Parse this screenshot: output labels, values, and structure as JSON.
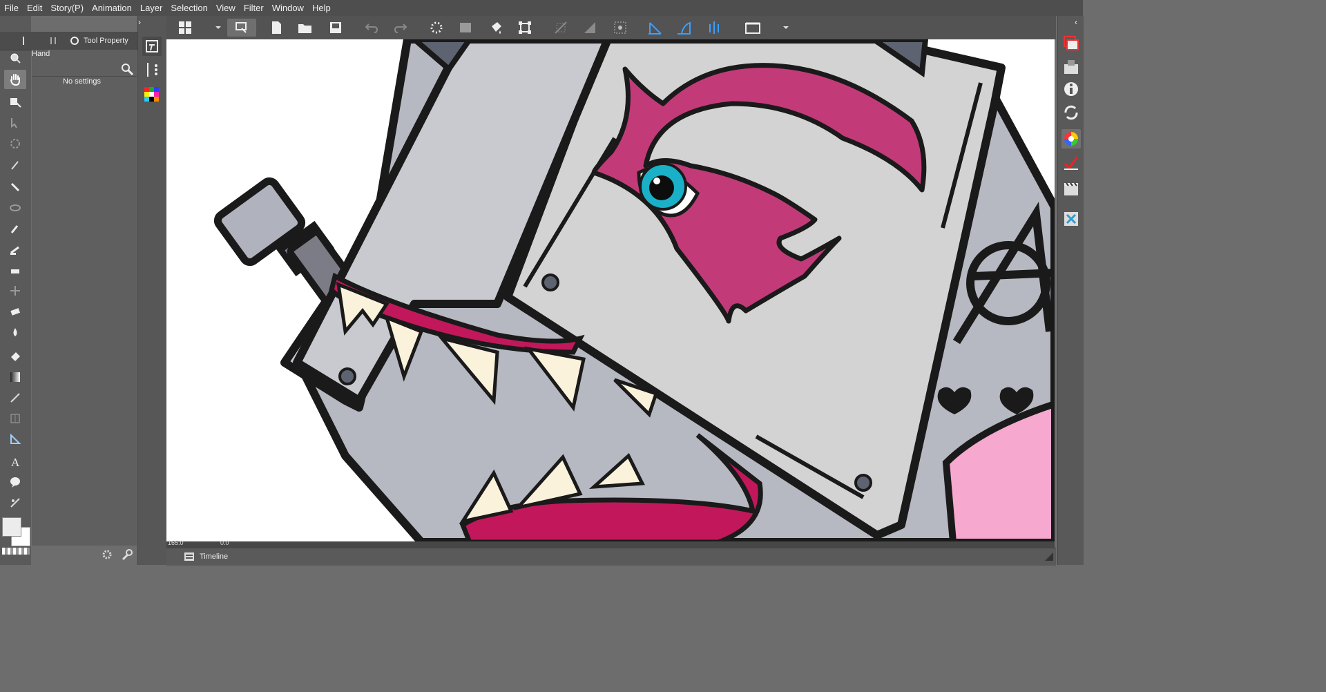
{
  "menu": [
    "File",
    "Edit",
    "Story(P)",
    "Animation",
    "Layer",
    "Selection",
    "View",
    "Filter",
    "Window",
    "Help"
  ],
  "tool_property": {
    "tab_label": "Tool Property",
    "tool_name": "Hand",
    "message": "No settings"
  },
  "timeline": {
    "label": "Timeline"
  },
  "status": {
    "zoom": "165.0",
    "angle": "0.0"
  },
  "colors": {
    "menubar": "#4e4e4e",
    "panel": "#5f5f5f",
    "canvas": "#ffffff",
    "robot_gray": "#b4b6c0",
    "plate_gray": "#d3d3d3",
    "tongue_magenta": "#c2185b",
    "eye_cyan": "#1ab0c8",
    "tooth_cream": "#fbf2dc",
    "pink_cheek": "#f7a8cf"
  },
  "icons": {
    "left_tools": [
      "zoom-icon",
      "hand-icon",
      "move-layer-icon",
      "object-select-icon",
      "rotate-icon",
      "eyedropper-icon",
      "pen-icon",
      "lasso-icon",
      "brush-icon",
      "airbrush-icon",
      "decoration-icon",
      "blend-icon",
      "eraser-icon",
      "fill-icon",
      "gradient-icon",
      "line-icon",
      "frame-icon",
      "ruler-icon",
      "text-icon",
      "balloon-icon",
      "correct-line-icon"
    ],
    "right_panels": [
      "layer-panel-icon",
      "navigator-icon",
      "info-icon",
      "sync-icon",
      "color-wheel-icon",
      "sub-tool-icon",
      "animation-icon",
      "material-icon"
    ]
  }
}
